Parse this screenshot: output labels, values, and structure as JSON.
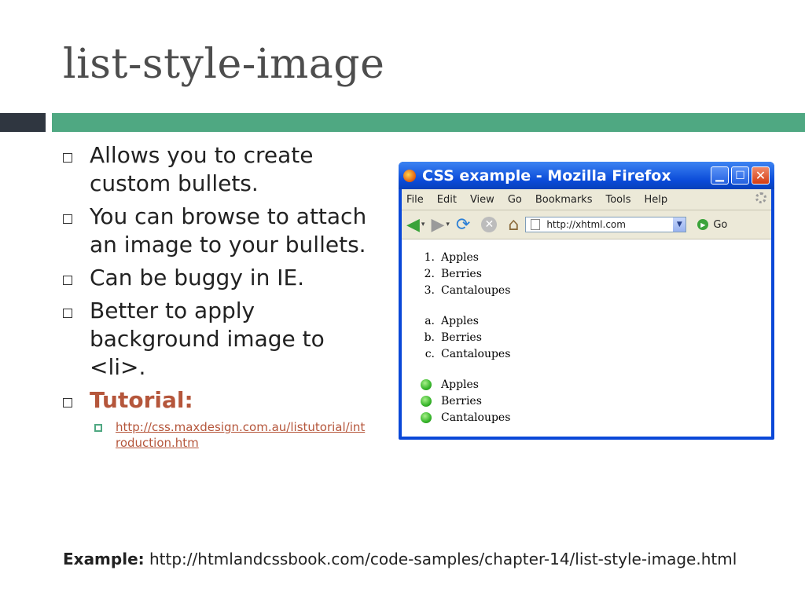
{
  "slide": {
    "title": "list-style-image",
    "bullets": [
      "Allows you to create custom bullets.",
      "You can browse to attach an image to your bullets.",
      "Can be buggy in IE.",
      "Better to apply background image to <li>.",
      "Tutorial:"
    ],
    "tutorial_link": "http://css.maxdesign.com.au/listutorial/introduction.htm",
    "example_label": "Example:",
    "example_url": "http://htmlandcssbook.com/code-samples/chapter-14/list-style-image.html"
  },
  "browser": {
    "window_title": "CSS example - Mozilla Firefox",
    "menu": [
      "File",
      "Edit",
      "View",
      "Go",
      "Bookmarks",
      "Tools",
      "Help"
    ],
    "url": "http://xhtml.com",
    "go_label": "Go",
    "list_decimal": {
      "markers": [
        "1.",
        "2.",
        "3."
      ],
      "items": [
        "Apples",
        "Berries",
        "Cantaloupes"
      ]
    },
    "list_alpha": {
      "markers": [
        "a.",
        "b.",
        "c."
      ],
      "items": [
        "Apples",
        "Berries",
        "Cantaloupes"
      ]
    },
    "list_image": {
      "items": [
        "Apples",
        "Berries",
        "Cantaloupes"
      ]
    },
    "icons": [
      "firefox-icon",
      "back-arrow-icon",
      "forward-arrow-icon",
      "reload-icon",
      "stop-icon",
      "home-icon",
      "page-icon",
      "go-icon",
      "throbber-icon"
    ]
  },
  "colors": {
    "accent_green": "#4fa882",
    "dark_bar": "#2f3640",
    "link": "#b5563b",
    "xp_blue": "#0a48d8"
  }
}
